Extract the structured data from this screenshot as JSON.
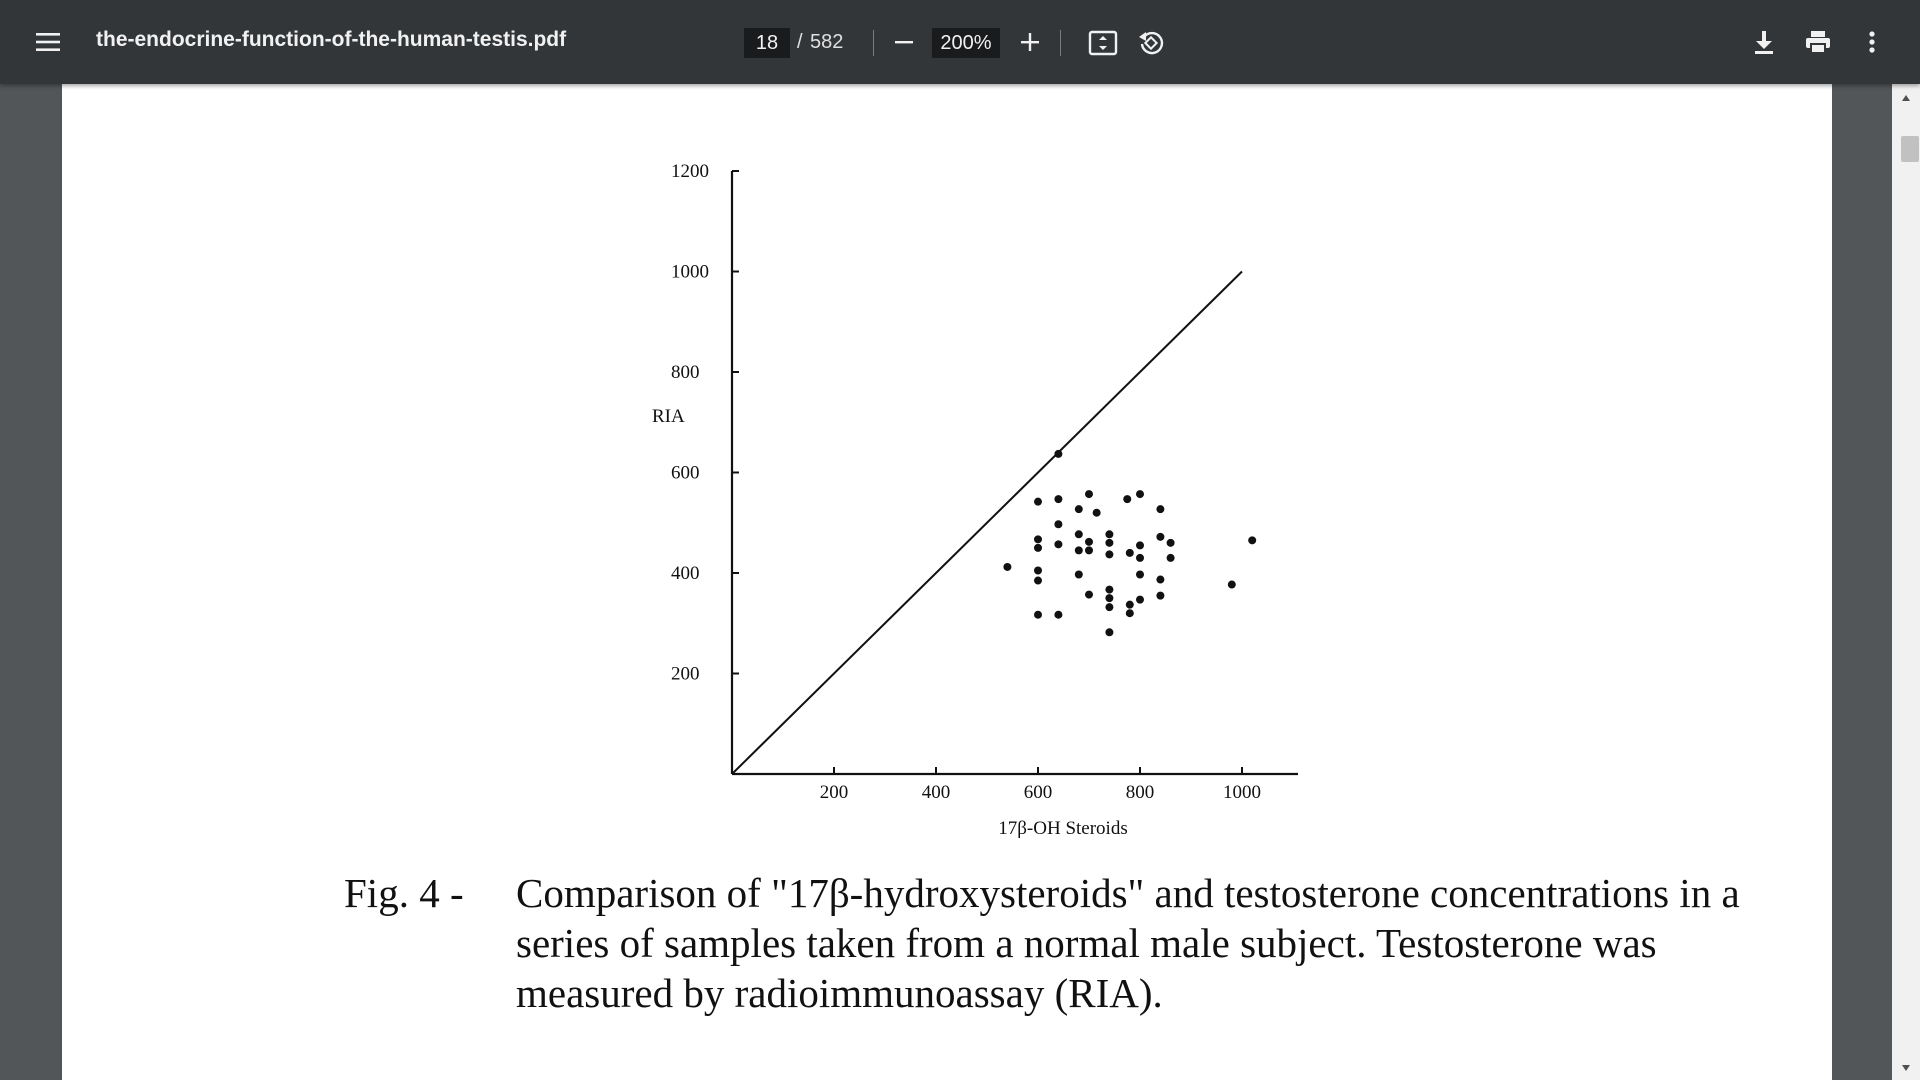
{
  "toolbar": {
    "title": "the-endocrine-function-of-the-human-testis.pdf",
    "page_current": "18",
    "page_separator": "/",
    "page_total": "582",
    "zoom": "200%"
  },
  "icons": {
    "menu": "hamburger-menu-icon",
    "zoom_out": "minus-icon",
    "zoom_in": "plus-icon",
    "fit": "fit-page-icon",
    "rotate": "rotate-counterclockwise-icon",
    "download": "download-icon",
    "print": "print-icon",
    "more": "more-vertical-icon"
  },
  "colors": {
    "toolbar_bg": "#323639",
    "viewer_bg": "#525659",
    "page_bg": "#ffffff",
    "input_bg": "#191b1c"
  },
  "chart_data": {
    "type": "scatter",
    "title": "",
    "xlabel": "17β-OH Steroids",
    "ylabel": "RIA",
    "xlim": [
      0,
      1100
    ],
    "ylim": [
      0,
      1200
    ],
    "x_ticks": [
      200,
      400,
      600,
      800,
      1000
    ],
    "x_tick_labels": [
      "200",
      "400",
      "600",
      "800",
      "1000"
    ],
    "y_ticks": [
      200,
      400,
      600,
      800,
      1000,
      1200
    ],
    "y_tick_labels": [
      "200",
      "400",
      "600",
      "800",
      "1000",
      "1200"
    ],
    "reference_line": {
      "x": [
        0,
        1000
      ],
      "y": [
        0,
        1000
      ]
    },
    "grid": false,
    "legend": "none",
    "series": [
      {
        "points": [
          [
            640,
            637
          ],
          [
            600,
            542
          ],
          [
            640,
            547
          ],
          [
            700,
            557
          ],
          [
            680,
            527
          ],
          [
            715,
            520
          ],
          [
            775,
            547
          ],
          [
            800,
            557
          ],
          [
            840,
            527
          ],
          [
            640,
            497
          ],
          [
            600,
            467
          ],
          [
            640,
            457
          ],
          [
            680,
            477
          ],
          [
            700,
            462
          ],
          [
            740,
            477
          ],
          [
            740,
            460
          ],
          [
            600,
            450
          ],
          [
            680,
            445
          ],
          [
            700,
            445
          ],
          [
            740,
            437
          ],
          [
            780,
            440
          ],
          [
            800,
            430
          ],
          [
            800,
            455
          ],
          [
            840,
            472
          ],
          [
            860,
            460
          ],
          [
            860,
            430
          ],
          [
            540,
            412
          ],
          [
            600,
            405
          ],
          [
            600,
            385
          ],
          [
            680,
            397
          ],
          [
            740,
            367
          ],
          [
            700,
            357
          ],
          [
            740,
            350
          ],
          [
            740,
            332
          ],
          [
            780,
            337
          ],
          [
            800,
            347
          ],
          [
            840,
            355
          ],
          [
            840,
            387
          ],
          [
            800,
            397
          ],
          [
            780,
            320
          ],
          [
            600,
            317
          ],
          [
            640,
            317
          ],
          [
            740,
            282
          ],
          [
            980,
            377
          ],
          [
            1020,
            465
          ]
        ]
      }
    ]
  },
  "caption": {
    "label": "Fig. 4 -",
    "text": "Comparison of \"17β-hydroxysteroids\" and testosterone concentrations in a series of samples taken from a normal male subject.   Testosterone was measured by radioimmunoassay (RIA)."
  }
}
